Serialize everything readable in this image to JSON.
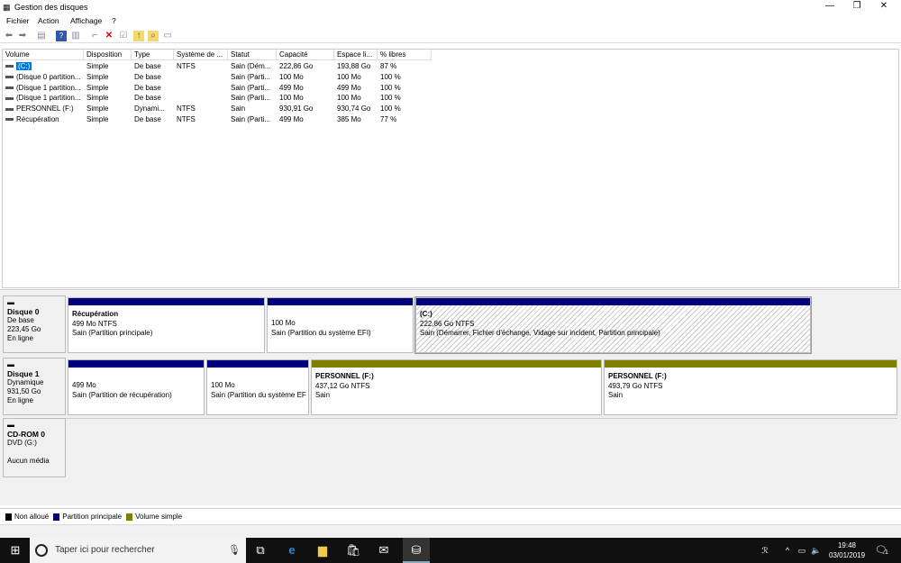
{
  "window": {
    "title": "Gestion des disques",
    "icon": "disk-management-icon"
  },
  "menu": [
    "Fichier",
    "Action",
    "Affichage",
    "?"
  ],
  "toolbar": [
    "back-arrow-icon",
    "forward-arrow-icon",
    "console-tree-icon",
    "help-icon",
    "panel-icon",
    "connect-icon",
    "delete-icon",
    "properties-icon",
    "folder-up-icon",
    "folder-search-icon",
    "view-icon"
  ],
  "table": {
    "columns": [
      "Volume",
      "Disposition",
      "Type",
      "Système de ...",
      "Statut",
      "Capacité",
      "Espace li...",
      "% libres"
    ],
    "rows": [
      [
        "(C:)",
        "Simple",
        "De base",
        "NTFS",
        "Sain (Dém...",
        "222,86 Go",
        "193,88 Go",
        "87 %"
      ],
      [
        "(Disque 0 partition...",
        "Simple",
        "De base",
        "",
        "Sain (Parti...",
        "100 Mo",
        "100 Mo",
        "100 %"
      ],
      [
        "(Disque 1 partition...",
        "Simple",
        "De base",
        "",
        "Sain (Parti...",
        "499 Mo",
        "499 Mo",
        "100 %"
      ],
      [
        "(Disque 1 partition...",
        "Simple",
        "De base",
        "",
        "Sain (Parti...",
        "100 Mo",
        "100 Mo",
        "100 %"
      ],
      [
        "PERSONNEL (F:)",
        "Simple",
        "Dynami...",
        "NTFS",
        "Sain",
        "930,91 Go",
        "930,74 Go",
        "100 %"
      ],
      [
        "Récupération",
        "Simple",
        "De base",
        "NTFS",
        "Sain (Parti...",
        "499 Mo",
        "385 Mo",
        "77 %"
      ]
    ]
  },
  "disks": [
    {
      "name": "Disque 0",
      "type": "De base",
      "size": "223,45 Go",
      "state": "En ligne",
      "partitions": [
        {
          "title": "Récupération",
          "size": "499 Mo NTFS",
          "status": "Sain (Partition principale)",
          "kind": "primary"
        },
        {
          "title": "",
          "size": "100 Mo",
          "status": "Sain (Partition du système EFI)",
          "kind": "primary"
        },
        {
          "title": "(C:)",
          "size": "222,86 Go NTFS",
          "status": "Sain (Démarrer, Fichier d'échange, Vidage sur incident, Partition principale)",
          "kind": "primary",
          "selected": true
        }
      ]
    },
    {
      "name": "Disque 1",
      "type": "Dynamique",
      "size": "931,50 Go",
      "state": "En ligne",
      "partitions": [
        {
          "title": "",
          "size": "499 Mo",
          "status": "Sain (Partition de récupération)",
          "kind": "primary"
        },
        {
          "title": "",
          "size": "100 Mo",
          "status": "Sain (Partition du système EF",
          "kind": "primary"
        },
        {
          "title": "PERSONNEL  (F:)",
          "size": "437,12 Go NTFS",
          "status": "Sain",
          "kind": "simple"
        },
        {
          "title": "PERSONNEL  (F:)",
          "size": "493,79 Go NTFS",
          "status": "Sain",
          "kind": "simple"
        }
      ]
    },
    {
      "name": "CD-ROM 0",
      "type": "DVD (G:)",
      "size": "",
      "state": "Aucun média"
    }
  ],
  "legend": [
    {
      "label": "Non alloué",
      "color": "#000000"
    },
    {
      "label": "Partition principale",
      "color": "#00007f"
    },
    {
      "label": "Volume simple",
      "color": "#808000"
    }
  ],
  "taskbar": {
    "search_placeholder": "Taper ici pour rechercher",
    "time": "19:48",
    "date": "03/01/2019",
    "notifications": "1"
  }
}
